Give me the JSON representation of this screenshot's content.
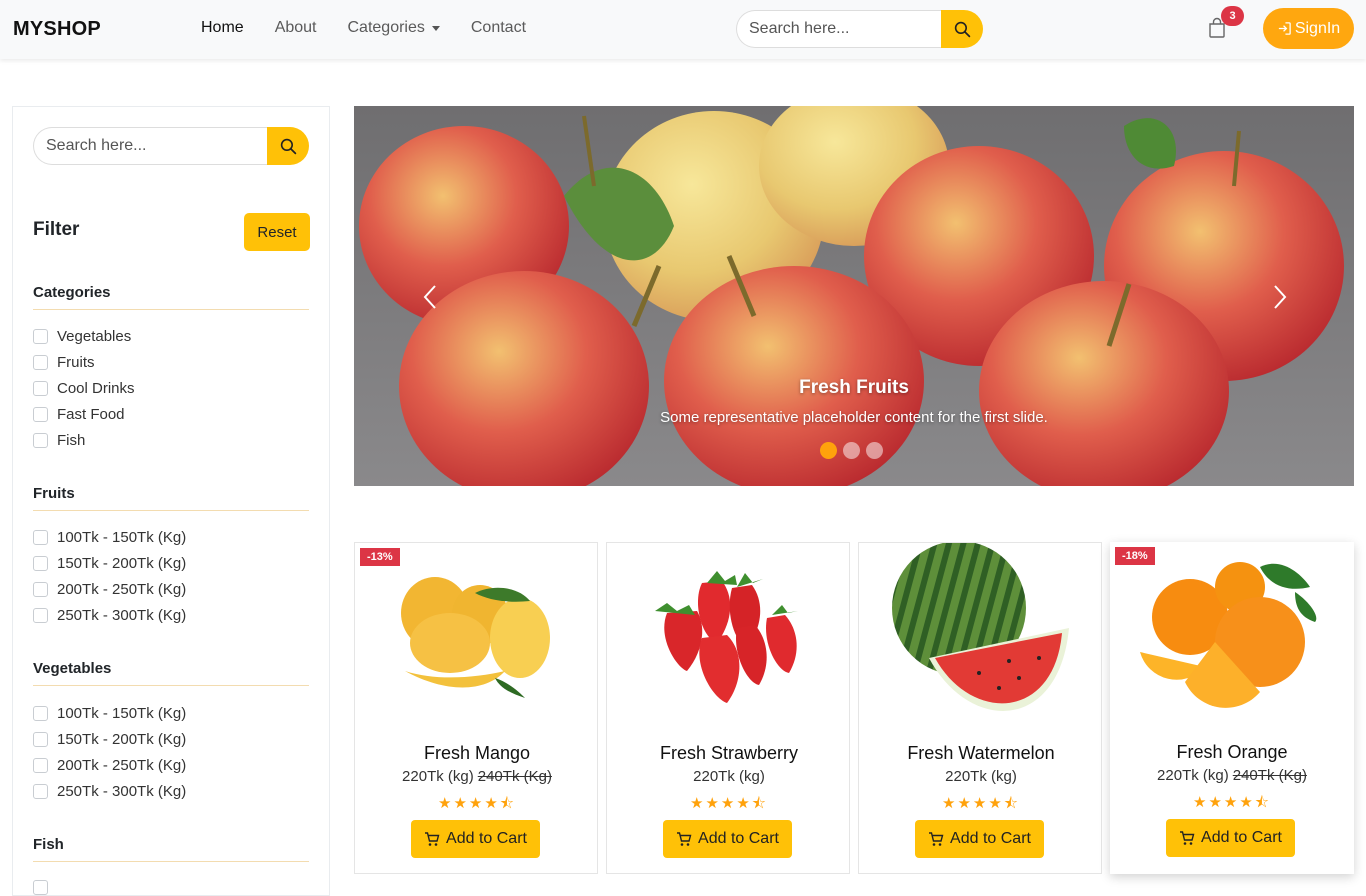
{
  "navbar": {
    "brand": "MYSHOP",
    "links": [
      "Home",
      "About",
      "Categories",
      "Contact"
    ],
    "search_placeholder": "Search here...",
    "cart_count": "3",
    "signin_label": "SignIn"
  },
  "sidebar": {
    "search_placeholder": "Search here...",
    "filter_title": "Filter",
    "reset_label": "Reset",
    "groups": [
      {
        "title": "Categories",
        "options": [
          "Vegetables",
          "Fruits",
          "Cool Drinks",
          "Fast Food",
          "Fish"
        ]
      },
      {
        "title": "Fruits",
        "options": [
          "100Tk - 150Tk (Kg)",
          "150Tk - 200Tk (Kg)",
          "200Tk - 250Tk (Kg)",
          "250Tk - 300Tk (Kg)"
        ]
      },
      {
        "title": "Vegetables",
        "options": [
          "100Tk - 150Tk (Kg)",
          "150Tk - 200Tk (Kg)",
          "200Tk - 250Tk (Kg)",
          "250Tk - 300Tk (Kg)"
        ]
      },
      {
        "title": "Fish",
        "options": []
      }
    ]
  },
  "carousel": {
    "title": "Fresh Fruits",
    "text": "Some representative placeholder content for the first slide.",
    "slide_count": 3,
    "active_index": 0
  },
  "products": [
    {
      "name": "Fresh Mango",
      "price": "220Tk (kg)",
      "old_price": "240Tk (Kg)",
      "discount": "-13%",
      "rating": 4.5,
      "button": "Add to Cart"
    },
    {
      "name": "Fresh Strawberry",
      "price": "220Tk (kg)",
      "old_price": "",
      "discount": "",
      "rating": 4.5,
      "button": "Add to Cart"
    },
    {
      "name": "Fresh Watermelon",
      "price": "220Tk (kg)",
      "old_price": "",
      "discount": "",
      "rating": 4.5,
      "button": "Add to Cart"
    },
    {
      "name": "Fresh Orange",
      "price": "220Tk (kg)",
      "old_price": "240Tk (Kg)",
      "discount": "-18%",
      "rating": 4.5,
      "button": "Add to Cart"
    }
  ],
  "colors": {
    "accent": "#ffc107",
    "signin": "#ffa70f",
    "badge": "#dc3545",
    "star": "#ffa20c"
  }
}
